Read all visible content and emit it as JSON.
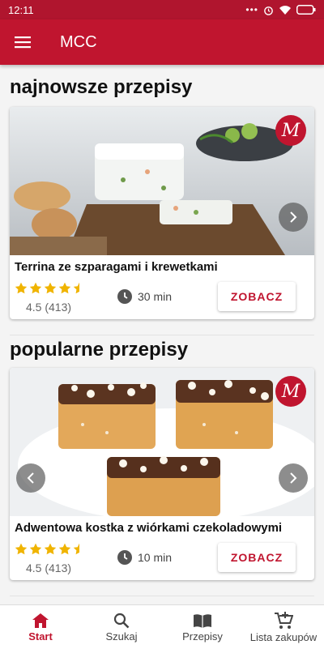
{
  "status_bar": {
    "time": "12:11"
  },
  "app_bar": {
    "title": "MCC"
  },
  "sections": [
    {
      "title": "najnowsze przepisy",
      "card": {
        "name": "Terrina ze szparagami i krewetkami",
        "rating": "4.5 (413)",
        "rating_value": 4.5,
        "time": "30 min",
        "button": "ZOBACZ"
      }
    },
    {
      "title": "popularne przepisy",
      "card": {
        "name": "Adwentowa kostka z wiórkami czekoladowymi",
        "rating": "4.5 (413)",
        "rating_value": 4.5,
        "time": "10 min",
        "button": "ZOBACZ"
      }
    }
  ],
  "bottom_nav": [
    {
      "label": "Start",
      "icon": "home-icon",
      "active": true
    },
    {
      "label": "Szukaj",
      "icon": "search-icon",
      "active": false
    },
    {
      "label": "Przepisy",
      "icon": "book-icon",
      "active": false
    },
    {
      "label": "Lista zakupów",
      "icon": "cart-icon",
      "active": false
    }
  ],
  "colors": {
    "accent": "#c0152f",
    "star": "#f0b400"
  }
}
